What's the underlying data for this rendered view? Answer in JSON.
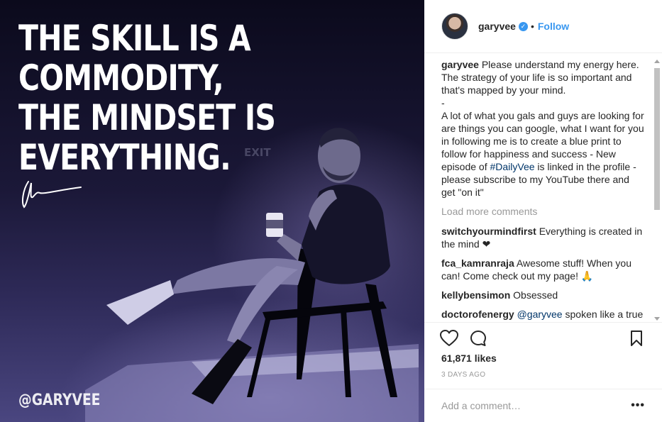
{
  "photo": {
    "quote_lines": [
      "THE SKILL IS A",
      "COMMODITY,",
      "THE MINDSET IS",
      "EVERYTHING."
    ],
    "watermark": "@GARYVEE",
    "background_sign": "EXIT"
  },
  "header": {
    "username": "garyvee",
    "separator": "•",
    "follow_label": "Follow",
    "verified_icon": "verified-badge-icon"
  },
  "caption": {
    "username": "garyvee",
    "text_1": "Please understand my energy here. The strategy of your life is so important and that's mapped by your mind.",
    "text_2": "-",
    "text_3": "A lot of what you gals and guys are looking for are things you can google, what I want for you in following me is to create a blue print to follow for happiness and success - New episode of ",
    "hashtag": "#DailyVee",
    "text_4": " is linked in the profile - please subscribe to my YouTube there and get \"on it\""
  },
  "load_more": "Load more comments",
  "comments": [
    {
      "username": "switchyourmindfirst",
      "text": "Everything is created in the mind ❤",
      "mention": ""
    },
    {
      "username": "fca_kamranraja",
      "text": "Awesome stuff! When you can! Come check out my page! 🙏",
      "mention": ""
    },
    {
      "username": "kellybensimon",
      "text": "Obsessed",
      "mention": ""
    },
    {
      "username": "doctorofenergy",
      "text": " spoken like a true Dream builder. Definitely understand",
      "mention": "@garyvee"
    }
  ],
  "actions": {
    "like_icon": "heart-icon",
    "comment_icon": "comment-bubble-icon",
    "save_icon": "bookmark-icon"
  },
  "likes": "61,871 likes",
  "date": "3 DAYS AGO",
  "add_comment": {
    "placeholder": "Add a comment…",
    "more_icon": "more-options-icon",
    "more_label": "•••"
  },
  "colors": {
    "link_blue": "#3897f0",
    "hashtag_blue": "#003569",
    "muted_gray": "#999999",
    "text": "#262626"
  }
}
